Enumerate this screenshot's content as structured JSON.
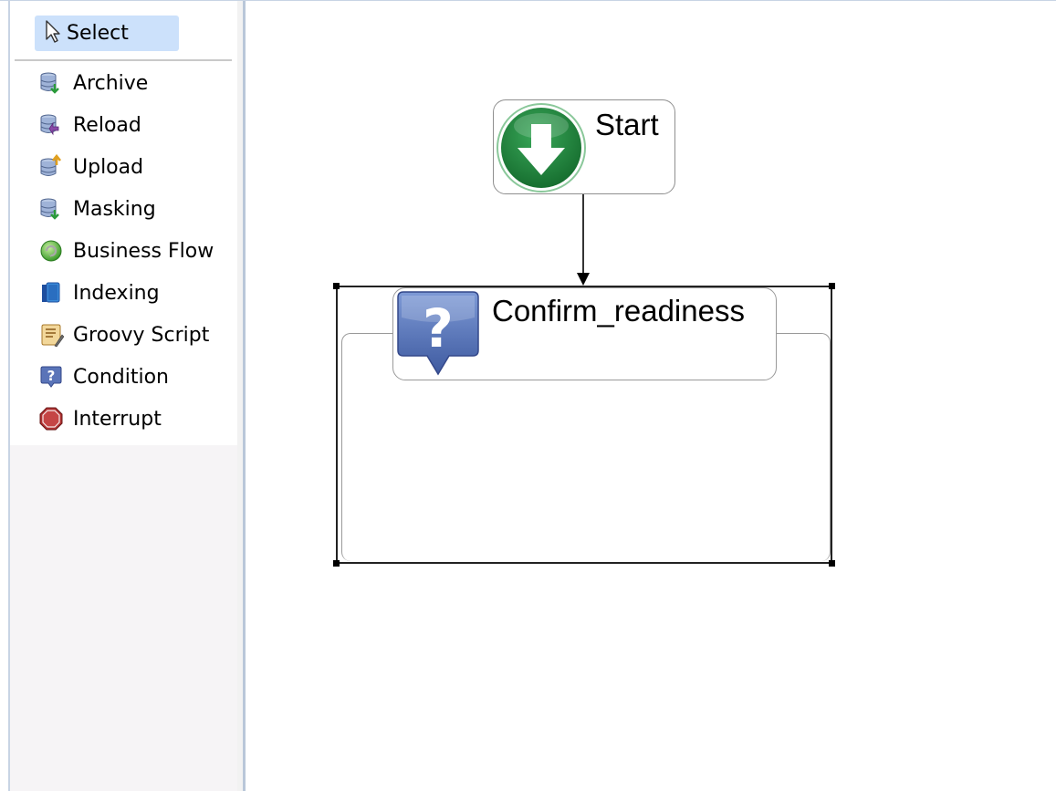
{
  "palette": {
    "select_label": "Select",
    "items": [
      {
        "label": "Archive",
        "icon": "archive-db-icon"
      },
      {
        "label": "Reload",
        "icon": "reload-db-icon"
      },
      {
        "label": "Upload",
        "icon": "upload-db-icon"
      },
      {
        "label": "Masking",
        "icon": "masking-db-icon"
      },
      {
        "label": "Business Flow",
        "icon": "business-flow-icon"
      },
      {
        "label": "Indexing",
        "icon": "indexing-icon"
      },
      {
        "label": "Groovy Script",
        "icon": "script-icon"
      },
      {
        "label": "Condition",
        "icon": "condition-icon"
      },
      {
        "label": "Interrupt",
        "icon": "interrupt-icon"
      }
    ]
  },
  "canvas": {
    "start_node_label": "Start",
    "condition_node_label": "Confirm_readiness"
  },
  "colors": {
    "selection_highlight": "#cce1fb",
    "start_green": "#1f8a3a",
    "condition_blue": "#4a64a8",
    "interrupt_red": "#b03030"
  }
}
